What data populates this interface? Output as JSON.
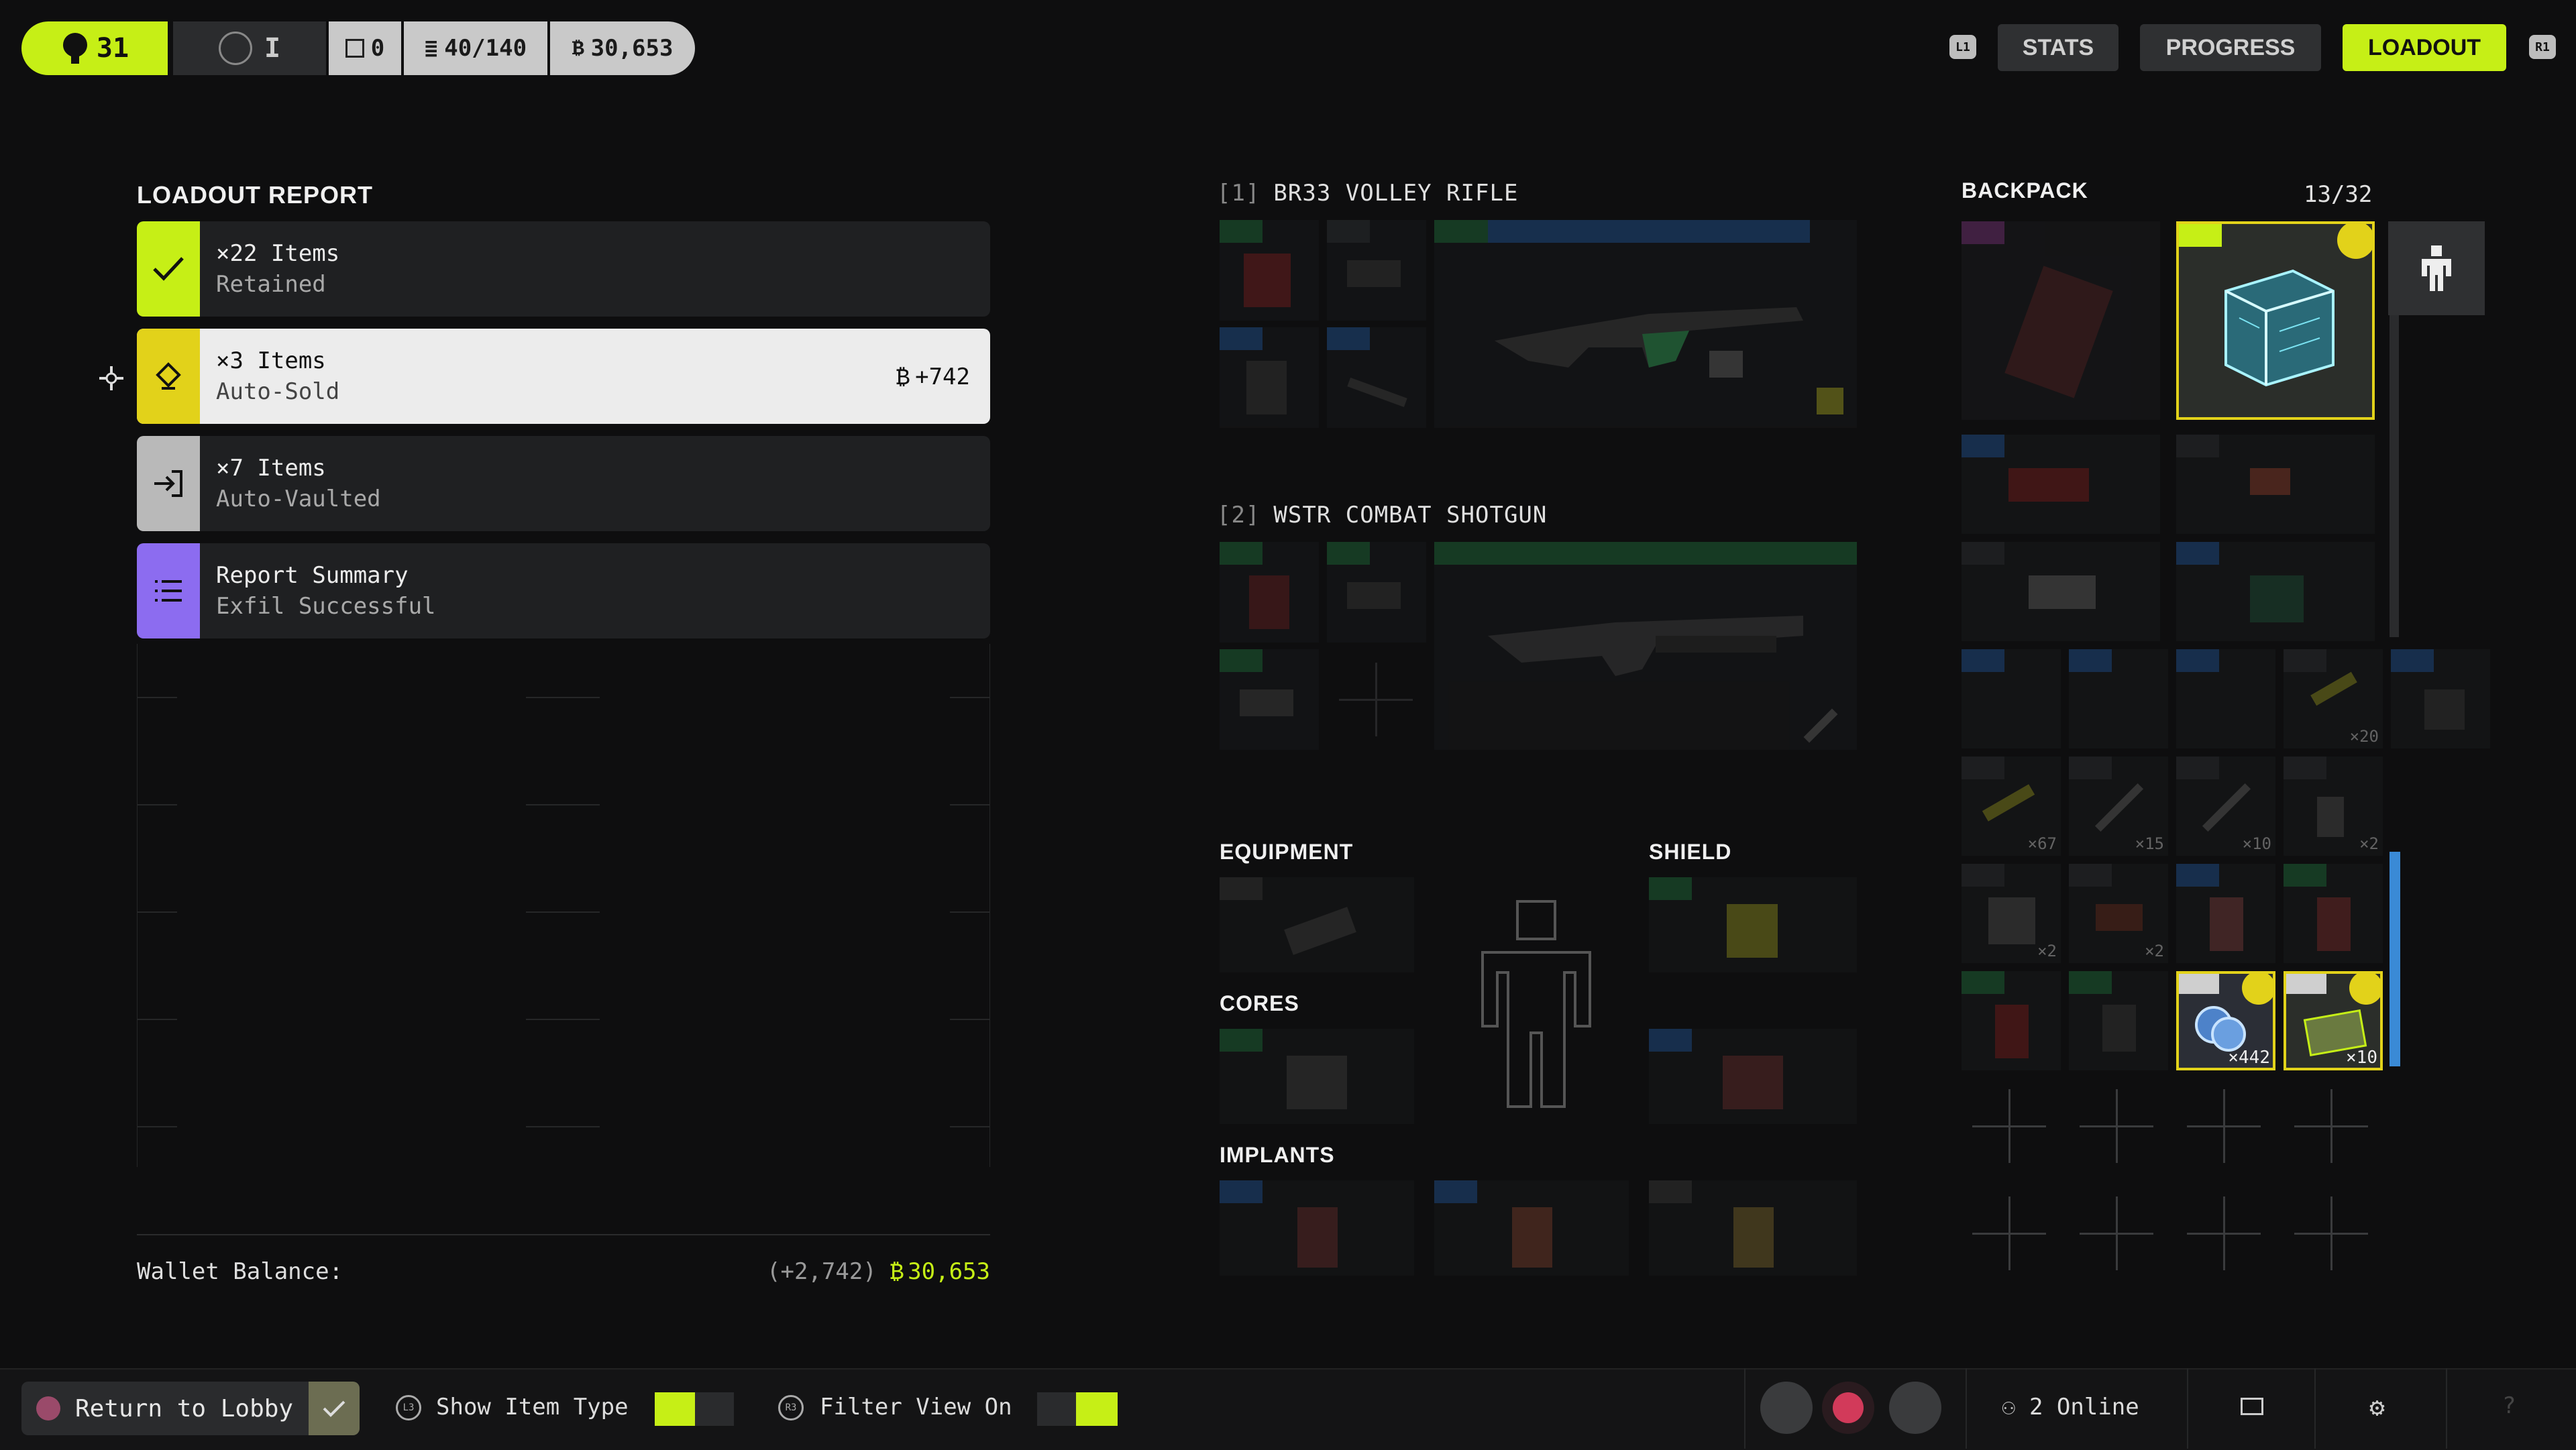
{
  "topbar": {
    "level": "31",
    "rank": "I",
    "stat_a": "0",
    "stat_b": "40/140",
    "stat_c": "30,653",
    "shoulder_left": "L1",
    "shoulder_right": "R1",
    "tabs": [
      {
        "label": "STATS"
      },
      {
        "label": "PROGRESS"
      },
      {
        "label": "LOADOUT"
      }
    ]
  },
  "report": {
    "title": "LOADOUT REPORT",
    "rows": [
      {
        "line1": "×22 Items",
        "line2": "Retained",
        "accent": "#c6ef16"
      },
      {
        "line1": "×3 Items",
        "line2": "Auto-Sold",
        "value": "+742",
        "accent": "#e2d21a"
      },
      {
        "line1": "×7 Items",
        "line2": "Auto-Vaulted",
        "accent": "#b9b9b9"
      },
      {
        "line1": "Report Summary",
        "line2": "Exfil Successful",
        "accent": "#8c6cf0"
      }
    ],
    "wallet_label": "Wallet Balance:",
    "wallet_change": "(+2,742)",
    "wallet_total": "30,653"
  },
  "weapons": [
    {
      "slot": "[1]",
      "name": "BR33 VOLLEY RIFLE"
    },
    {
      "slot": "[2]",
      "name": "WSTR COMBAT SHOTGUN"
    }
  ],
  "sections": {
    "equipment": "EQUIPMENT",
    "shield": "SHIELD",
    "cores": "CORES",
    "implants": "IMPLANTS"
  },
  "backpack": {
    "title": "BACKPACK",
    "count": "13/32",
    "qty": [
      "×67",
      "×15",
      "×10",
      "×2",
      "×2",
      "×2",
      "×442",
      "×10",
      "×20"
    ]
  },
  "bottom": {
    "return_label": "Return to Lobby",
    "show_item_type": "Show Item Type",
    "filter_view": "Filter View On",
    "online": "2 Online",
    "hint_l3": "L3",
    "hint_r3": "R3"
  },
  "colors": {
    "accent_green": "#c6ef16",
    "accent_yellow": "#e2d21a",
    "accent_purple": "#8c6cf0",
    "background": "#0e0e0f"
  }
}
